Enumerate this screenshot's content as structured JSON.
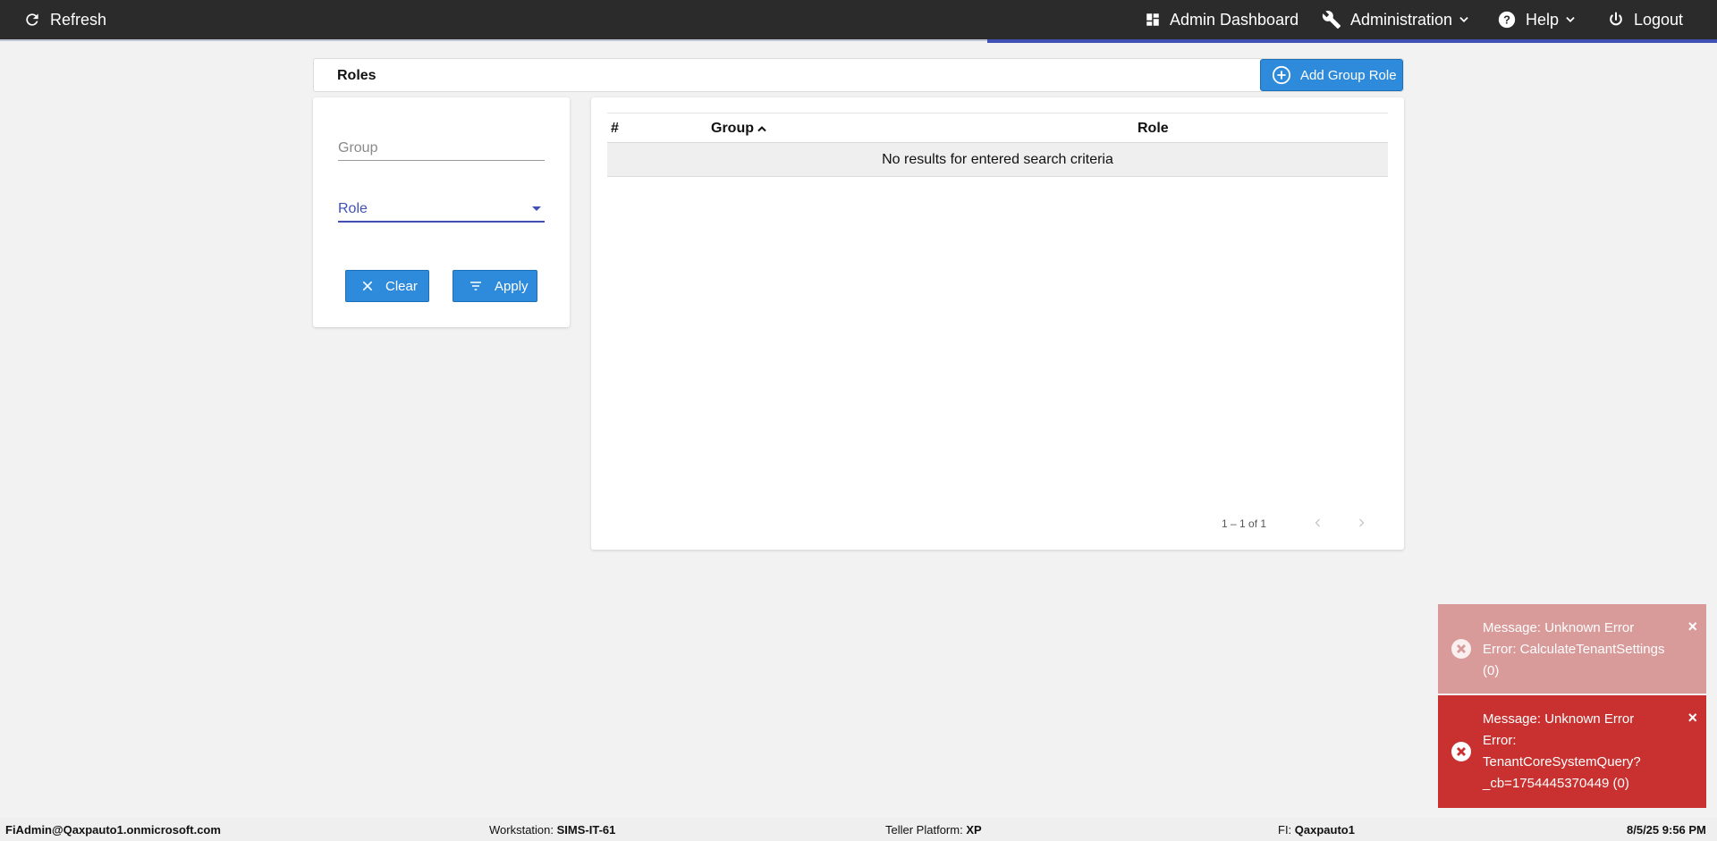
{
  "topbar": {
    "refresh_label": "Refresh",
    "admin_dashboard_label": "Admin Dashboard",
    "administration_label": "Administration",
    "help_label": "Help",
    "logout_label": "Logout"
  },
  "page": {
    "title": "Roles",
    "add_button_label": "Add Group Role"
  },
  "filters": {
    "group_placeholder": "Group",
    "role_label": "Role",
    "clear_label": "Clear",
    "apply_label": "Apply"
  },
  "table": {
    "columns": [
      "#",
      "Group",
      "Role"
    ],
    "sorted_column": "Group",
    "empty_message": "No results for entered search criteria",
    "pagination_label": "1 – 1 of 1"
  },
  "toasts": [
    {
      "lines": [
        "Message: Unknown Error",
        "Error: CalculateTenantSettings",
        "(0)"
      ]
    },
    {
      "lines": [
        "Message: Unknown Error",
        "Error:",
        "TenantCoreSystemQuery?",
        "_cb=1754445370449 (0)"
      ]
    }
  ],
  "footer": {
    "user": "FiAdmin@Qaxpauto1.onmicrosoft.com",
    "workstation_label": "Workstation:",
    "workstation_value": "SIMS-IT-61",
    "platform_label": "Teller Platform:",
    "platform_value": "XP",
    "fi_label": "FI:",
    "fi_value": "Qaxpauto1",
    "datetime": "8/5/25 9:56 PM"
  },
  "colors": {
    "topbar_bg": "#2b2b2b",
    "accent": "#3f51b5",
    "button_blue": "#2e8bdc",
    "toast_error": "#c8312f",
    "toast_error_faded": "#d99a9a"
  }
}
